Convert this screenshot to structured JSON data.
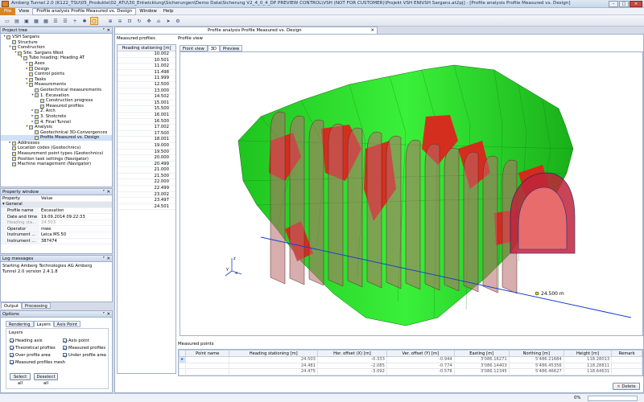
{
  "window": {
    "title": "Amberg Tunnel 2.0 (K122_TSU\\05_Produkte\\02_ATU\\30_Entwicklung\\Sicherungen\\Demo Data\\Sicherung V2_4_0_4_DP PREVIEW CONTROL\\VSH (NOT FOR CUSTOMER)\\Projekt VSH ENIVSH Sargans.at2pj] - [Profile analysis Profile Measured vs. Design]",
    "icon": "app-icon",
    "buttons": [
      "–",
      "□",
      "✕"
    ]
  },
  "menu": {
    "items": [
      "File",
      "View",
      "Profile analysis Profile Measured vs. Design",
      "Window",
      "Help"
    ]
  },
  "toolbar": {
    "buttons": [
      "new-icon",
      "open-icon",
      "save-icon",
      "grid-icon",
      "grid-icon",
      "table-icon",
      "table-icon",
      "add-icon",
      "star-icon",
      "select-icon",
      "zoom-in-icon",
      "zoom-out-icon",
      "zoom-fit-icon",
      "rotate-icon",
      "pan-icon",
      "home-icon",
      "navigate-icon",
      "settings-icon"
    ]
  },
  "project_tree": {
    "title": "Project tree",
    "items": [
      {
        "label": "VSH Sargans",
        "level": 0,
        "arrow": "▾"
      },
      {
        "label": "Structure",
        "level": 1,
        "arrow": ""
      },
      {
        "label": "Construction",
        "level": 1,
        "arrow": "▾"
      },
      {
        "label": "Site: Sargans West",
        "level": 2,
        "arrow": "▾"
      },
      {
        "label": "Tube heading: Heading AT",
        "level": 3,
        "arrow": "▾"
      },
      {
        "label": "Axes",
        "level": 4,
        "arrow": "▸"
      },
      {
        "label": "Design",
        "level": 4,
        "arrow": "▸"
      },
      {
        "label": "Control points",
        "level": 4,
        "arrow": ""
      },
      {
        "label": "Tasks",
        "level": 4,
        "arrow": "▸"
      },
      {
        "label": "Measurements",
        "level": 4,
        "arrow": "▾"
      },
      {
        "label": "Geotechnical measurements",
        "level": 5,
        "arrow": ""
      },
      {
        "label": "1. Excavation",
        "level": 5,
        "arrow": "▾"
      },
      {
        "label": "Construction progress",
        "level": 6,
        "arrow": ""
      },
      {
        "label": "Measured profiles",
        "level": 6,
        "arrow": ""
      },
      {
        "label": "2. Arch",
        "level": 5,
        "arrow": "▸"
      },
      {
        "label": "3. Shotcrete",
        "level": 5,
        "arrow": "▸"
      },
      {
        "label": "4. Final Tunnel",
        "level": 5,
        "arrow": "▸"
      },
      {
        "label": "Analysis",
        "level": 4,
        "arrow": "▾"
      },
      {
        "label": "Geotechnical 3D-Convergences",
        "level": 5,
        "arrow": ""
      },
      {
        "label": "Profile Measured vs. Design",
        "level": 5,
        "arrow": "",
        "selected": true
      },
      {
        "label": "Addresses",
        "level": 1,
        "arrow": "▸"
      },
      {
        "label": "Location codes (Geotechnics)",
        "level": 1,
        "arrow": ""
      },
      {
        "label": "Measurement point types (Geotechnics)",
        "level": 1,
        "arrow": ""
      },
      {
        "label": "Position task settings (Navigator)",
        "level": 1,
        "arrow": ""
      },
      {
        "label": "Machine management (Navigator)",
        "level": 1,
        "arrow": ""
      }
    ]
  },
  "property_window": {
    "title": "Property window",
    "col_property": "Property",
    "col_value": "Value",
    "group": "General",
    "rows": [
      {
        "k": "Profile name",
        "v": "Excavation",
        "dim": false
      },
      {
        "k": "Date and time",
        "v": "19.09.2014 09:22:33",
        "dim": false
      },
      {
        "k": "Heading sta...",
        "v": "24.503",
        "dim": true
      },
      {
        "k": "Operator",
        "v": "mwe",
        "dim": false
      },
      {
        "k": "Instrument ...",
        "v": "Leica MS 50",
        "dim": false
      },
      {
        "k": "Instrument ...",
        "v": "387474",
        "dim": false
      }
    ]
  },
  "log": {
    "title": "Log messages",
    "text": "Starting Amberg Technologies AG Amberg Tunnel 2.0 version 2.4.1.8"
  },
  "bottom_tabs": [
    "Output",
    "Processing"
  ],
  "options": {
    "title": "Options",
    "tabs": [
      "Rendering",
      "Layers",
      "Axis Point"
    ],
    "group_label": "Layers",
    "checks_left": [
      "Heading axis",
      "Theoretical profiles",
      "Over profile area",
      "Measured profiles mesh"
    ],
    "checks_right": [
      "Axis point",
      "Measured profiles",
      "Under profile area"
    ],
    "select_all": "Select all",
    "deselect_all": "Deselect all"
  },
  "document_tab": "Profile analysis Profile Measured vs. Design",
  "measured_profiles": {
    "title": "Measured profiles",
    "header": "Heading stationing [m]",
    "values": [
      "10.002",
      "10.501",
      "11.002",
      "11.498",
      "11.999",
      "12.500",
      "13.000",
      "14.502",
      "15.001",
      "15.500",
      "16.001",
      "16.500",
      "17.002",
      "17.500",
      "18.001",
      "19.000",
      "19.500",
      "20.000",
      "20.499",
      "21.000",
      "21.500",
      "22.000",
      "22.499",
      "23.002",
      "23.497",
      "24.501"
    ]
  },
  "profile_view": {
    "title": "Profile view",
    "tabs": [
      "Front view",
      "3D",
      "Preview"
    ],
    "active_tab": "3D",
    "station_label": "24.500 m",
    "axis_x": "x",
    "axis_y": "y",
    "axis_z": "z",
    "colors": {
      "over": "#1fdc1f",
      "under": "#e81e1e",
      "section": "#b86a6a",
      "axis": "#1a3fd0"
    }
  },
  "measured_points": {
    "title": "Measured points",
    "headers": [
      "Point name",
      "Heading stationing [m]",
      "Hor. offset (X) [m]",
      "Ver. offset (Y) [m]",
      "Easting [m]",
      "Northing [m]",
      "Height [m]",
      "Remark"
    ],
    "rows": [
      [
        "",
        "24.503",
        "-0.333",
        "-0.944",
        "3'086.16271",
        "5'486.21684",
        "118.28013",
        ""
      ],
      [
        "",
        "24.481",
        "-2.085",
        "-0.774",
        "3'086.14403",
        "5'486.45356",
        "118.28811",
        ""
      ],
      [
        "",
        "24.475",
        "-3.092",
        "-0.578",
        "3'086.12345",
        "5'486.46627",
        "118.64631",
        ""
      ]
    ],
    "delete_label": "Delete"
  },
  "status": {
    "progress_text": "0%",
    "progress": 0
  }
}
